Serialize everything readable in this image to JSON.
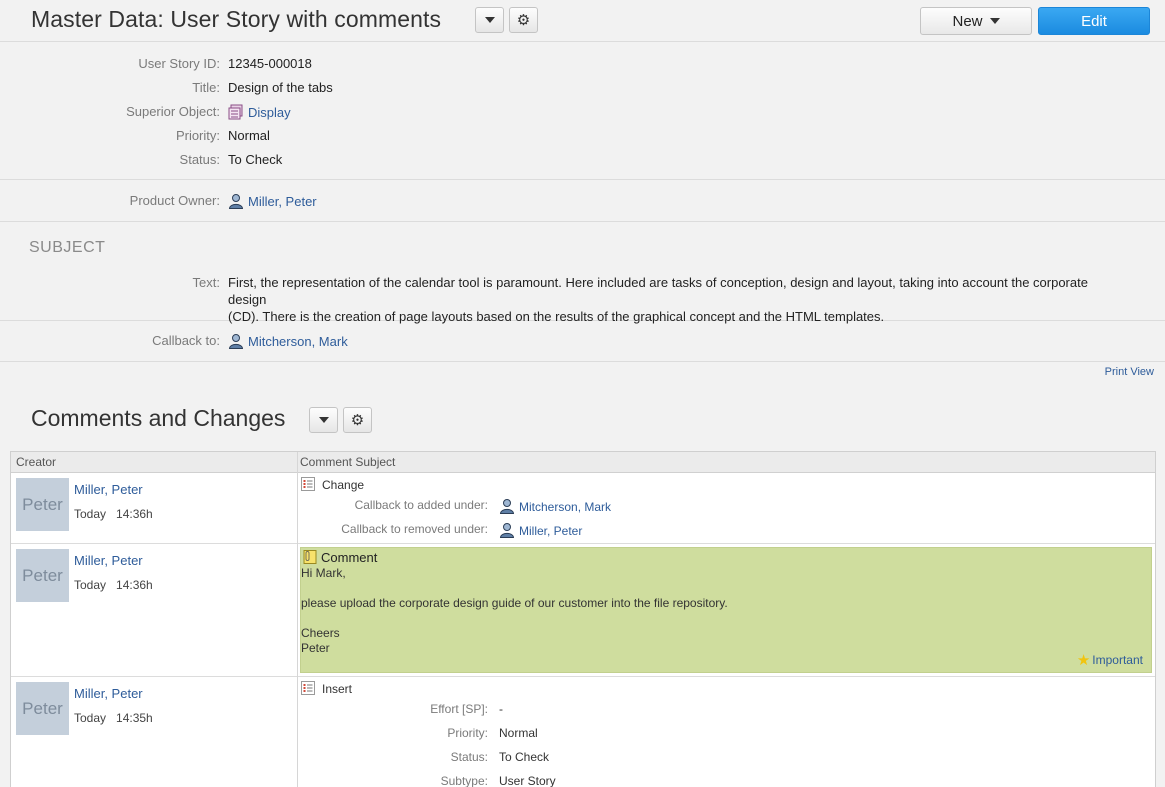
{
  "header": {
    "title": "Master Data: User Story with comments",
    "new_label": "New",
    "edit_label": "Edit"
  },
  "details": {
    "user_story_id": {
      "label": "User Story ID:",
      "value": "12345-000018"
    },
    "title": {
      "label": "Title:",
      "value": "Design of the tabs"
    },
    "superior_object": {
      "label": "Superior Object:",
      "value": "Display"
    },
    "priority": {
      "label": "Priority:",
      "value": "Normal"
    },
    "status": {
      "label": "Status:",
      "value": "To Check"
    }
  },
  "owner": {
    "label": "Product Owner:",
    "value": "Miller, Peter"
  },
  "subject": {
    "heading": "SUBJECT",
    "text_label": "Text:",
    "text_line1": "First, the representation of the calendar tool is paramount. Here included are tasks of conception, design and layout, taking into account the corporate design",
    "text_line2": "(CD). There is the creation of page layouts based on the results of the graphical concept and the HTML templates."
  },
  "callback": {
    "label": "Callback to:",
    "value": "Mitcherson, Mark"
  },
  "print_view": "Print View",
  "comments": {
    "heading": "Comments and Changes",
    "col_creator": "Creator",
    "col_subject": "Comment Subject",
    "rows": [
      {
        "avatar": "Peter",
        "name": "Miller, Peter",
        "day": "Today",
        "time": "14:36h",
        "type": "Change",
        "details": [
          {
            "label": "Callback to added under:",
            "value": "Mitcherson, Mark"
          },
          {
            "label": "Callback to removed under:",
            "value": "Miller, Peter"
          }
        ]
      },
      {
        "avatar": "Peter",
        "name": "Miller, Peter",
        "day": "Today",
        "time": "14:36h",
        "type": "Comment",
        "body": [
          "Hi Mark,",
          "please upload the corporate design guide of our customer into the file repository.",
          "Cheers",
          "Peter"
        ],
        "flag": "Important"
      },
      {
        "avatar": "Peter",
        "name": "Miller, Peter",
        "day": "Today",
        "time": "14:35h",
        "type": "Insert",
        "details": [
          {
            "label": "Effort [SP]:",
            "value": "-"
          },
          {
            "label": "Priority:",
            "value": "Normal"
          },
          {
            "label": "Status:",
            "value": "To Check"
          },
          {
            "label": "Subtype:",
            "value": "User Story"
          }
        ]
      }
    ]
  },
  "colors": {
    "accent": "#1b8be0",
    "link": "#2e5c9a",
    "comment_bg": "#cfdd9e",
    "avatar_bg": "#c4cfdb"
  }
}
